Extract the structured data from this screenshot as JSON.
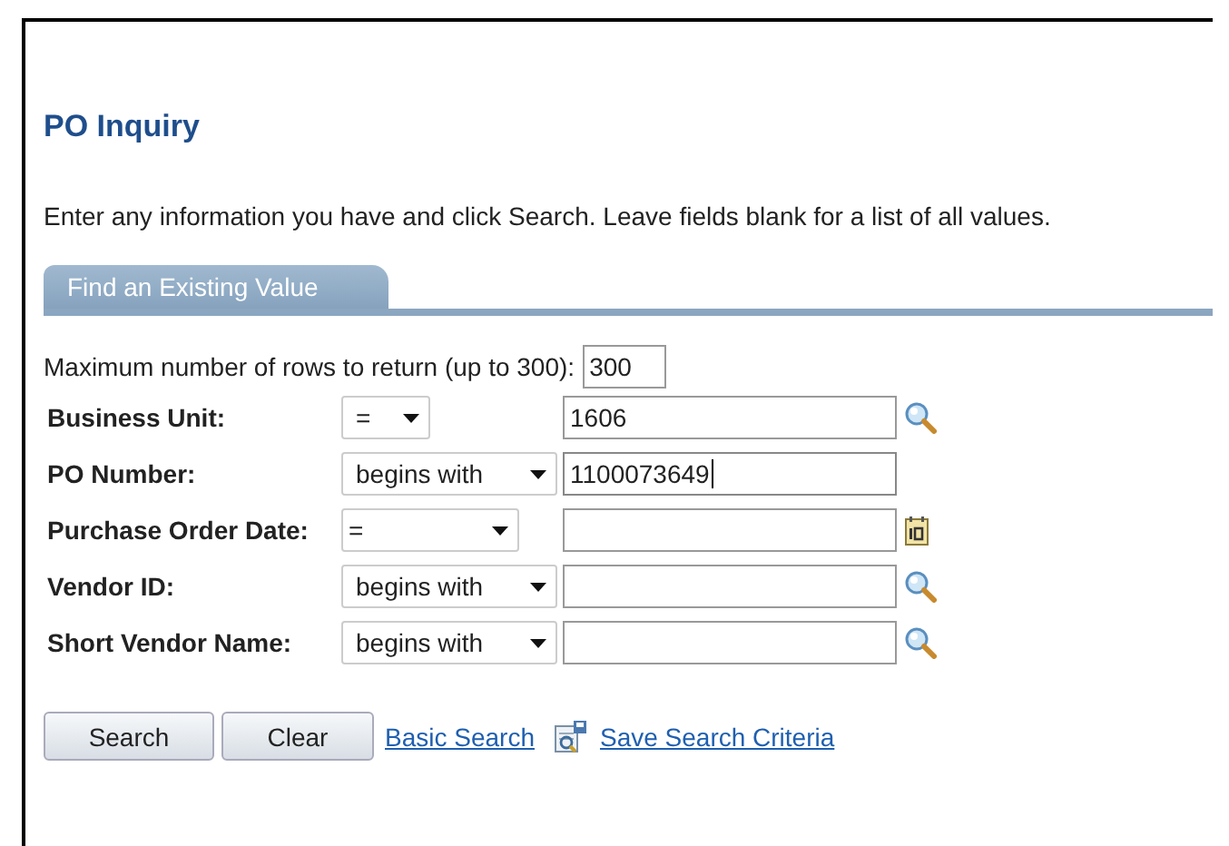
{
  "page": {
    "title": "PO Inquiry",
    "instructions": "Enter any information you have and click Search. Leave fields blank for a list of all values."
  },
  "tabs": [
    {
      "label": "Find an Existing Value",
      "selected": true
    }
  ],
  "max_rows": {
    "label": "Maximum number of rows to return (up to 300):",
    "value": "300"
  },
  "fields": [
    {
      "label": "Business Unit:",
      "operator": "=",
      "value": "1606",
      "focused": false,
      "kind": "lookup"
    },
    {
      "label": "PO Number:",
      "operator": "begins with",
      "value": "1100073649",
      "focused": true,
      "kind": "text"
    },
    {
      "label": "Purchase Order Date:",
      "operator": "=",
      "focused": false,
      "kind": "date"
    },
    {
      "label": "Vendor ID:",
      "operator": "begins with",
      "focused": false,
      "kind": "lookup"
    },
    {
      "label": "Short Vendor Name:",
      "operator": "begins with",
      "focused": false,
      "kind": "lookup"
    }
  ],
  "buttons": [
    "Search",
    "Clear"
  ],
  "links": [
    {
      "label": "Basic Search",
      "kind": "plain"
    },
    {
      "label": "Save Search Criteria",
      "kind": "save"
    }
  ]
}
